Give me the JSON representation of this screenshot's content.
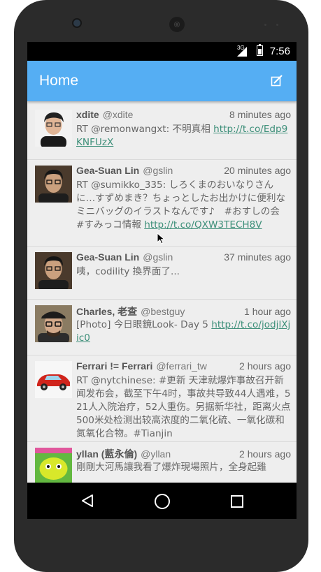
{
  "status_bar": {
    "network": "3G",
    "time": "7:56"
  },
  "app_bar": {
    "title": "Home",
    "compose_icon": "compose-icon"
  },
  "colors": {
    "app_bar": "#55aef3",
    "link": "#3d8f79",
    "timeline_bg": "#eeeeee"
  },
  "tweets": [
    {
      "name": "xdite",
      "handle": "@xdite",
      "time": "8 minutes ago",
      "text": "RT @remonwangxt: 不明真相 ",
      "link": "http://t.co/Edp9KNFUzX",
      "avatar": "avatar-woman-glasses"
    },
    {
      "name": "Gea-Suan Lin",
      "handle": "@gslin",
      "time": "20 minutes ago",
      "text": "RT @sumikko_335: しろくまのおいなりさんに…すずめまき？ちょっとしたお出かけに便利なミニバッグのイラストなんです♪　#おすしの会　#すみっコ情報 ",
      "link": "http://t.co/QXW3TECH8V",
      "avatar": "avatar-man-glasses"
    },
    {
      "name": "Gea-Suan Lin",
      "handle": "@gslin",
      "time": "37 minutes ago",
      "text": "咦，codility 換界面了...",
      "link": "",
      "avatar": "avatar-man-glasses"
    },
    {
      "name": "Charles, 老查",
      "handle": "@bestguy",
      "time": "1 hour ago",
      "text": "[Photo] 今日眼鏡Look- Day 5 ",
      "link": "http://t.co/jodjlXjic0",
      "avatar": "avatar-man-hat"
    },
    {
      "name": "Ferrari != Ferrari",
      "handle": "@ferrari_tw",
      "time": "2 hours ago",
      "text": "RT @nytchinese: #更新 天津就爆炸事故召开新闻发布会，截至下午4时，事故共导致44人遇难，521人入院治疗，52人重伤。另据新华社，距离火点500米处检测出较高浓度的二氧化硫、一氧化碳和氮氧化合物。#Tianjin",
      "link": "",
      "avatar": "avatar-red-car"
    },
    {
      "name": "yllan (藍永倫)",
      "handle": "@yllan",
      "time": "2 hours ago",
      "text": "剛剛大河馬讓我看了爆炸現場照片，全身起雞",
      "link": "",
      "avatar": "avatar-cartoon"
    }
  ],
  "nav_bar": {
    "back": "back-icon",
    "home": "home-icon",
    "recents": "recents-icon"
  }
}
